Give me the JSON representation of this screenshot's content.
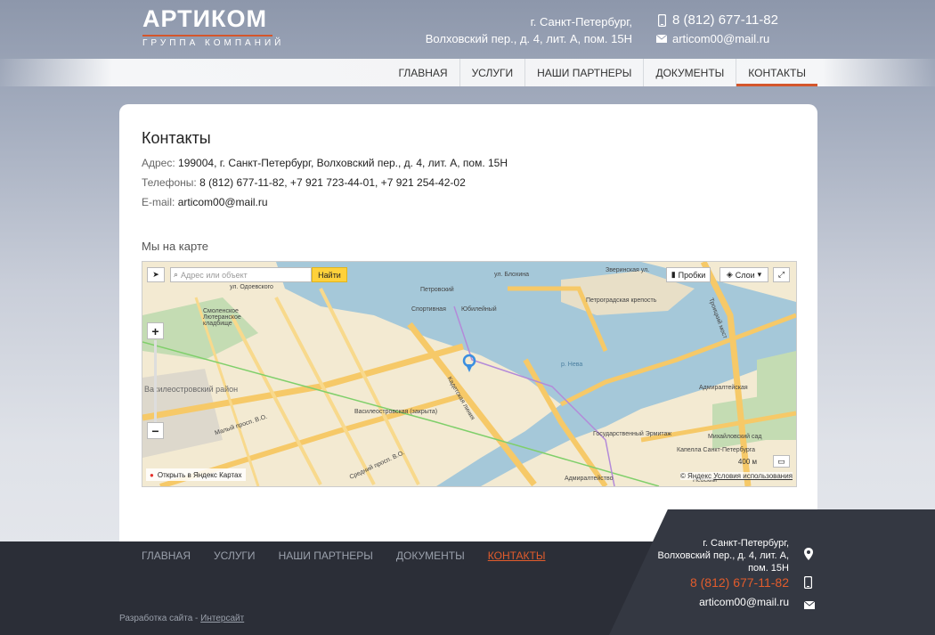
{
  "header": {
    "logo_title": "АРТИКОМ",
    "logo_subtitle": "ГРУППА КОМПАНИЙ",
    "address_line1": "г. Санкт-Петербург,",
    "address_line2": "Волховский пер., д. 4, лит. А, пом. 15Н",
    "phone": "8 (812) 677-11-82",
    "email": "articom00@mail.ru"
  },
  "nav": {
    "items": [
      {
        "label": "Главная"
      },
      {
        "label": "Услуги"
      },
      {
        "label": "Наши партнеры"
      },
      {
        "label": "Документы"
      },
      {
        "label": "Контакты",
        "active": true
      }
    ]
  },
  "content": {
    "title": "Контакты",
    "address_label": "Адрес:",
    "address_value": "199004, г. Санкт-Петербург, Волховский пер., д. 4, лит. А, пом. 15Н",
    "phones_label": "Телефоны:",
    "phones_value": "8 (812) 677-11-82, +7 921 723-44-01, +7 921 254-42-02",
    "email_label": "E-mail:",
    "email_value": "articom00@mail.ru",
    "map_title": "Мы на карте"
  },
  "map": {
    "search_placeholder": "Адрес или объект",
    "search_button": "Найти",
    "traffic_button": "Пробки",
    "layers_button": "Слои",
    "open_in_yandex": "Открыть в Яндекс Картах",
    "copyright": "© Яндекс",
    "terms": "Условия использования",
    "scale": "400 м",
    "labels": [
      "Петроградская крепость",
      "Спортивная",
      "Юбилейный",
      "Петровский",
      "Василеостровский район",
      "Василеостровская (закрыта)",
      "Кадетская линия",
      "Малый просп. В.О.",
      "Средний просп. В.О.",
      "Государственный Эрмитаж",
      "Адмиралтейство",
      "Михайловский сад",
      "Троицкий мост",
      "р. Нева",
      "Невский",
      "ул. Одоевского",
      "Смоленское Лютеранское кладбище",
      "Капелла Санкт-Петербурга",
      "Адмиралтейская",
      "Зверинская ул.",
      "ул. Блохина"
    ]
  },
  "footer": {
    "nav": [
      {
        "label": "Главная"
      },
      {
        "label": "Услуги"
      },
      {
        "label": "Наши партнеры"
      },
      {
        "label": "Документы"
      },
      {
        "label": "Контакты",
        "active": true
      }
    ],
    "address_line1": "г. Санкт-Петербург,",
    "address_line2": "Волховский пер., д. 4, лит. А,",
    "address_line3": "пом. 15Н",
    "phone": "8 (812) 677-11-82",
    "email": "articom00@mail.ru",
    "dev_text": "Разработка сайта - ",
    "dev_link": "Интерсайт"
  },
  "colors": {
    "accent": "#d4562b",
    "footer_bg": "#2b2e37",
    "search_button": "#ffd13b"
  }
}
